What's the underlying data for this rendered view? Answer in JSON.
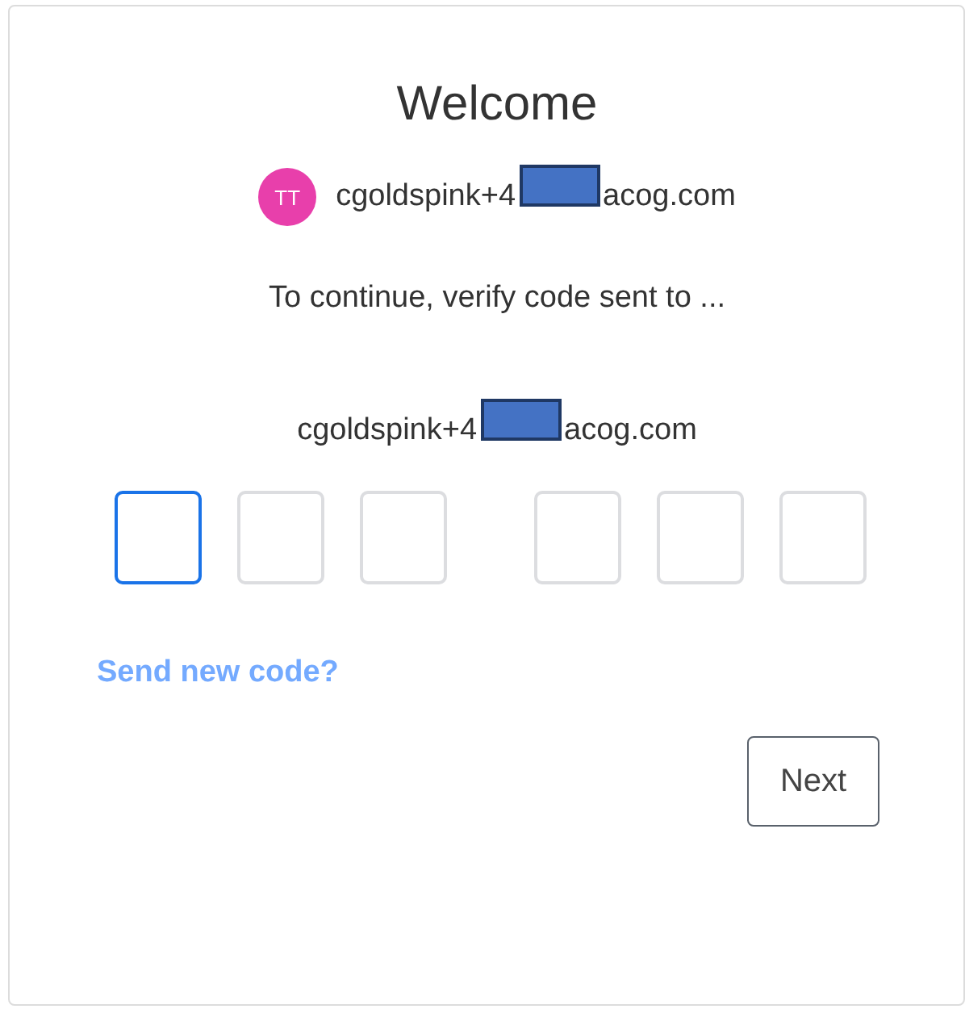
{
  "title": "Welcome",
  "account": {
    "initials": "TT",
    "color": "#e83fab",
    "email_start": "cgoldspink+4",
    "email_end": "acog.com"
  },
  "message": "To continue, verify code sent to ...",
  "sent_to": {
    "email_start": "cgoldspink+4",
    "email_end": "acog.com"
  },
  "code_groups": [
    [
      {
        "focused": true
      },
      {
        "focused": false
      },
      {
        "focused": false
      }
    ],
    [
      {
        "focused": false
      },
      {
        "focused": false
      },
      {
        "focused": false
      }
    ]
  ],
  "resend_link": "Send new code?",
  "next_button": "Next"
}
